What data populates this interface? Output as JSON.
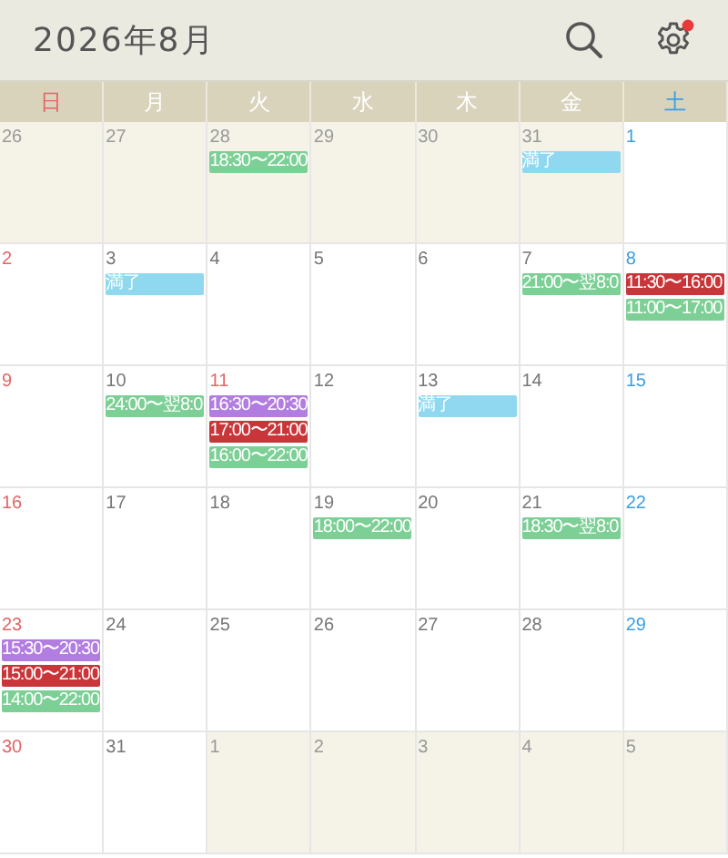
{
  "header": {
    "title": "2026年8月",
    "settings": {
      "has_notification": true
    }
  },
  "weekdays": [
    {
      "label": "日",
      "color": "#e26666"
    },
    {
      "label": "月",
      "color": "#ffffff"
    },
    {
      "label": "火",
      "color": "#ffffff"
    },
    {
      "label": "水",
      "color": "#ffffff"
    },
    {
      "label": "木",
      "color": "#ffffff"
    },
    {
      "label": "金",
      "color": "#ffffff"
    },
    {
      "label": "土",
      "color": "#3b9ee3"
    }
  ],
  "weeks": [
    [
      {
        "day": "26",
        "color": "#999999",
        "in_month": false
      },
      {
        "day": "27",
        "color": "#999999",
        "in_month": false
      },
      {
        "day": "28",
        "color": "#999999",
        "in_month": false,
        "events": [
          {
            "text": "18:30〜22:00",
            "color": "#7ccf95"
          }
        ]
      },
      {
        "day": "29",
        "color": "#999999",
        "in_month": false
      },
      {
        "day": "30",
        "color": "#999999",
        "in_month": false
      },
      {
        "day": "31",
        "color": "#999999",
        "in_month": false,
        "events": [
          {
            "text": "満了",
            "color": "#8fd8f0"
          }
        ]
      },
      {
        "day": "1",
        "color": "#3b9ee3",
        "in_month": true
      }
    ],
    [
      {
        "day": "2",
        "color": "#e26666",
        "in_month": true
      },
      {
        "day": "3",
        "color": "#777777",
        "in_month": true,
        "events": [
          {
            "text": "満了",
            "color": "#8fd8f0"
          }
        ]
      },
      {
        "day": "4",
        "color": "#777777",
        "in_month": true
      },
      {
        "day": "5",
        "color": "#777777",
        "in_month": true
      },
      {
        "day": "6",
        "color": "#777777",
        "in_month": true
      },
      {
        "day": "7",
        "color": "#777777",
        "in_month": true,
        "events": [
          {
            "text": "21:00〜翌8:0",
            "color": "#7ccf95"
          }
        ]
      },
      {
        "day": "8",
        "color": "#3b9ee3",
        "in_month": true,
        "events": [
          {
            "text": "11:30〜16:00",
            "color": "#c8363a"
          },
          {
            "text": "11:00〜17:00",
            "color": "#7ccf95"
          }
        ]
      }
    ],
    [
      {
        "day": "9",
        "color": "#e26666",
        "in_month": true
      },
      {
        "day": "10",
        "color": "#777777",
        "in_month": true,
        "events": [
          {
            "text": "24:00〜翌8:0",
            "color": "#7ccf95"
          }
        ]
      },
      {
        "day": "11",
        "color": "#e26666",
        "in_month": true,
        "events": [
          {
            "text": "16:30〜20:30",
            "color": "#b27de0"
          },
          {
            "text": "17:00〜21:00",
            "color": "#c8363a"
          },
          {
            "text": "16:00〜22:00",
            "color": "#7ccf95"
          }
        ]
      },
      {
        "day": "12",
        "color": "#777777",
        "in_month": true
      },
      {
        "day": "13",
        "color": "#777777",
        "in_month": true,
        "events": [
          {
            "text": "満了",
            "color": "#8fd8f0"
          }
        ]
      },
      {
        "day": "14",
        "color": "#777777",
        "in_month": true
      },
      {
        "day": "15",
        "color": "#3b9ee3",
        "in_month": true
      }
    ],
    [
      {
        "day": "16",
        "color": "#e26666",
        "in_month": true
      },
      {
        "day": "17",
        "color": "#777777",
        "in_month": true
      },
      {
        "day": "18",
        "color": "#777777",
        "in_month": true
      },
      {
        "day": "19",
        "color": "#777777",
        "in_month": true,
        "events": [
          {
            "text": "18:00〜22:00",
            "color": "#7ccf95"
          }
        ]
      },
      {
        "day": "20",
        "color": "#777777",
        "in_month": true
      },
      {
        "day": "21",
        "color": "#777777",
        "in_month": true,
        "events": [
          {
            "text": "18:30〜翌8:0",
            "color": "#7ccf95"
          }
        ]
      },
      {
        "day": "22",
        "color": "#3b9ee3",
        "in_month": true
      }
    ],
    [
      {
        "day": "23",
        "color": "#e26666",
        "in_month": true,
        "events": [
          {
            "text": "15:30〜20:30",
            "color": "#b27de0"
          },
          {
            "text": "15:00〜21:00",
            "color": "#c8363a"
          },
          {
            "text": "14:00〜22:00",
            "color": "#7ccf95"
          }
        ]
      },
      {
        "day": "24",
        "color": "#777777",
        "in_month": true
      },
      {
        "day": "25",
        "color": "#777777",
        "in_month": true
      },
      {
        "day": "26",
        "color": "#777777",
        "in_month": true
      },
      {
        "day": "27",
        "color": "#777777",
        "in_month": true
      },
      {
        "day": "28",
        "color": "#777777",
        "in_month": true
      },
      {
        "day": "29",
        "color": "#3b9ee3",
        "in_month": true
      }
    ],
    [
      {
        "day": "30",
        "color": "#e26666",
        "in_month": true
      },
      {
        "day": "31",
        "color": "#777777",
        "in_month": true
      },
      {
        "day": "1",
        "color": "#999999",
        "in_month": false
      },
      {
        "day": "2",
        "color": "#999999",
        "in_month": false
      },
      {
        "day": "3",
        "color": "#999999",
        "in_month": false
      },
      {
        "day": "4",
        "color": "#999999",
        "in_month": false
      },
      {
        "day": "5",
        "color": "#999999",
        "in_month": false
      }
    ]
  ]
}
